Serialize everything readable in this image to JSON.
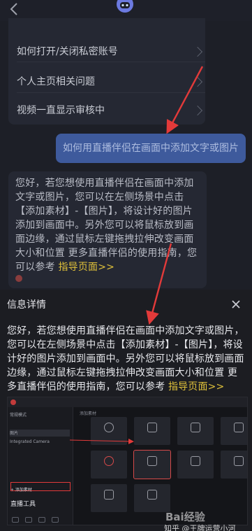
{
  "faq": {
    "items": [
      "如何打开/关闭私密账号",
      "个人主页相关问题",
      "视频一直显示审核中"
    ]
  },
  "chat": {
    "user_message": "如何用直播伴侣在画面中添加文字或图片",
    "bot_reply": {
      "text": "您好，若您想使用直播伴侣在画面中添加文字或图片，您可以在左侧场景中点击【添加素材】-【图片】，将设计好的图片添加到画面中。另外您可以将鼠标放到画面边缘，通过鼠标左键拖拽拉伸改变画面大小和位置 更多直播伴侣的使用指南，您可以参考 ",
      "link": "指导页面>>"
    }
  },
  "detail": {
    "title": "信息详情",
    "text": "您好，若您想使用直播伴侣在画面中添加文字或图片，您可以在左侧场景中点击【添加素材】-【图片】，将设计好的图片添加到画面中。另外您可以将鼠标放到画面边缘，通过鼠标左键拖拽拉伸改变画面大小和位置 更多直播伴侣的使用指南，您可以参考 ",
    "link": "指导页面>>"
  },
  "screenshot": {
    "scene_label": "常规模式",
    "rows": [
      "图片",
      "Integrated Camera"
    ],
    "add_label": "+ 添加素材",
    "tools_title": "直播工具",
    "panel_title": "添加素材"
  },
  "watermark": {
    "zhihu": "知乎 @王牌运营小河",
    "baidu": "Bai经验"
  },
  "colors": {
    "accent_link": "#e0c13a",
    "user_bubble": "#3e5a9c",
    "arrow": "#e23a3a"
  }
}
